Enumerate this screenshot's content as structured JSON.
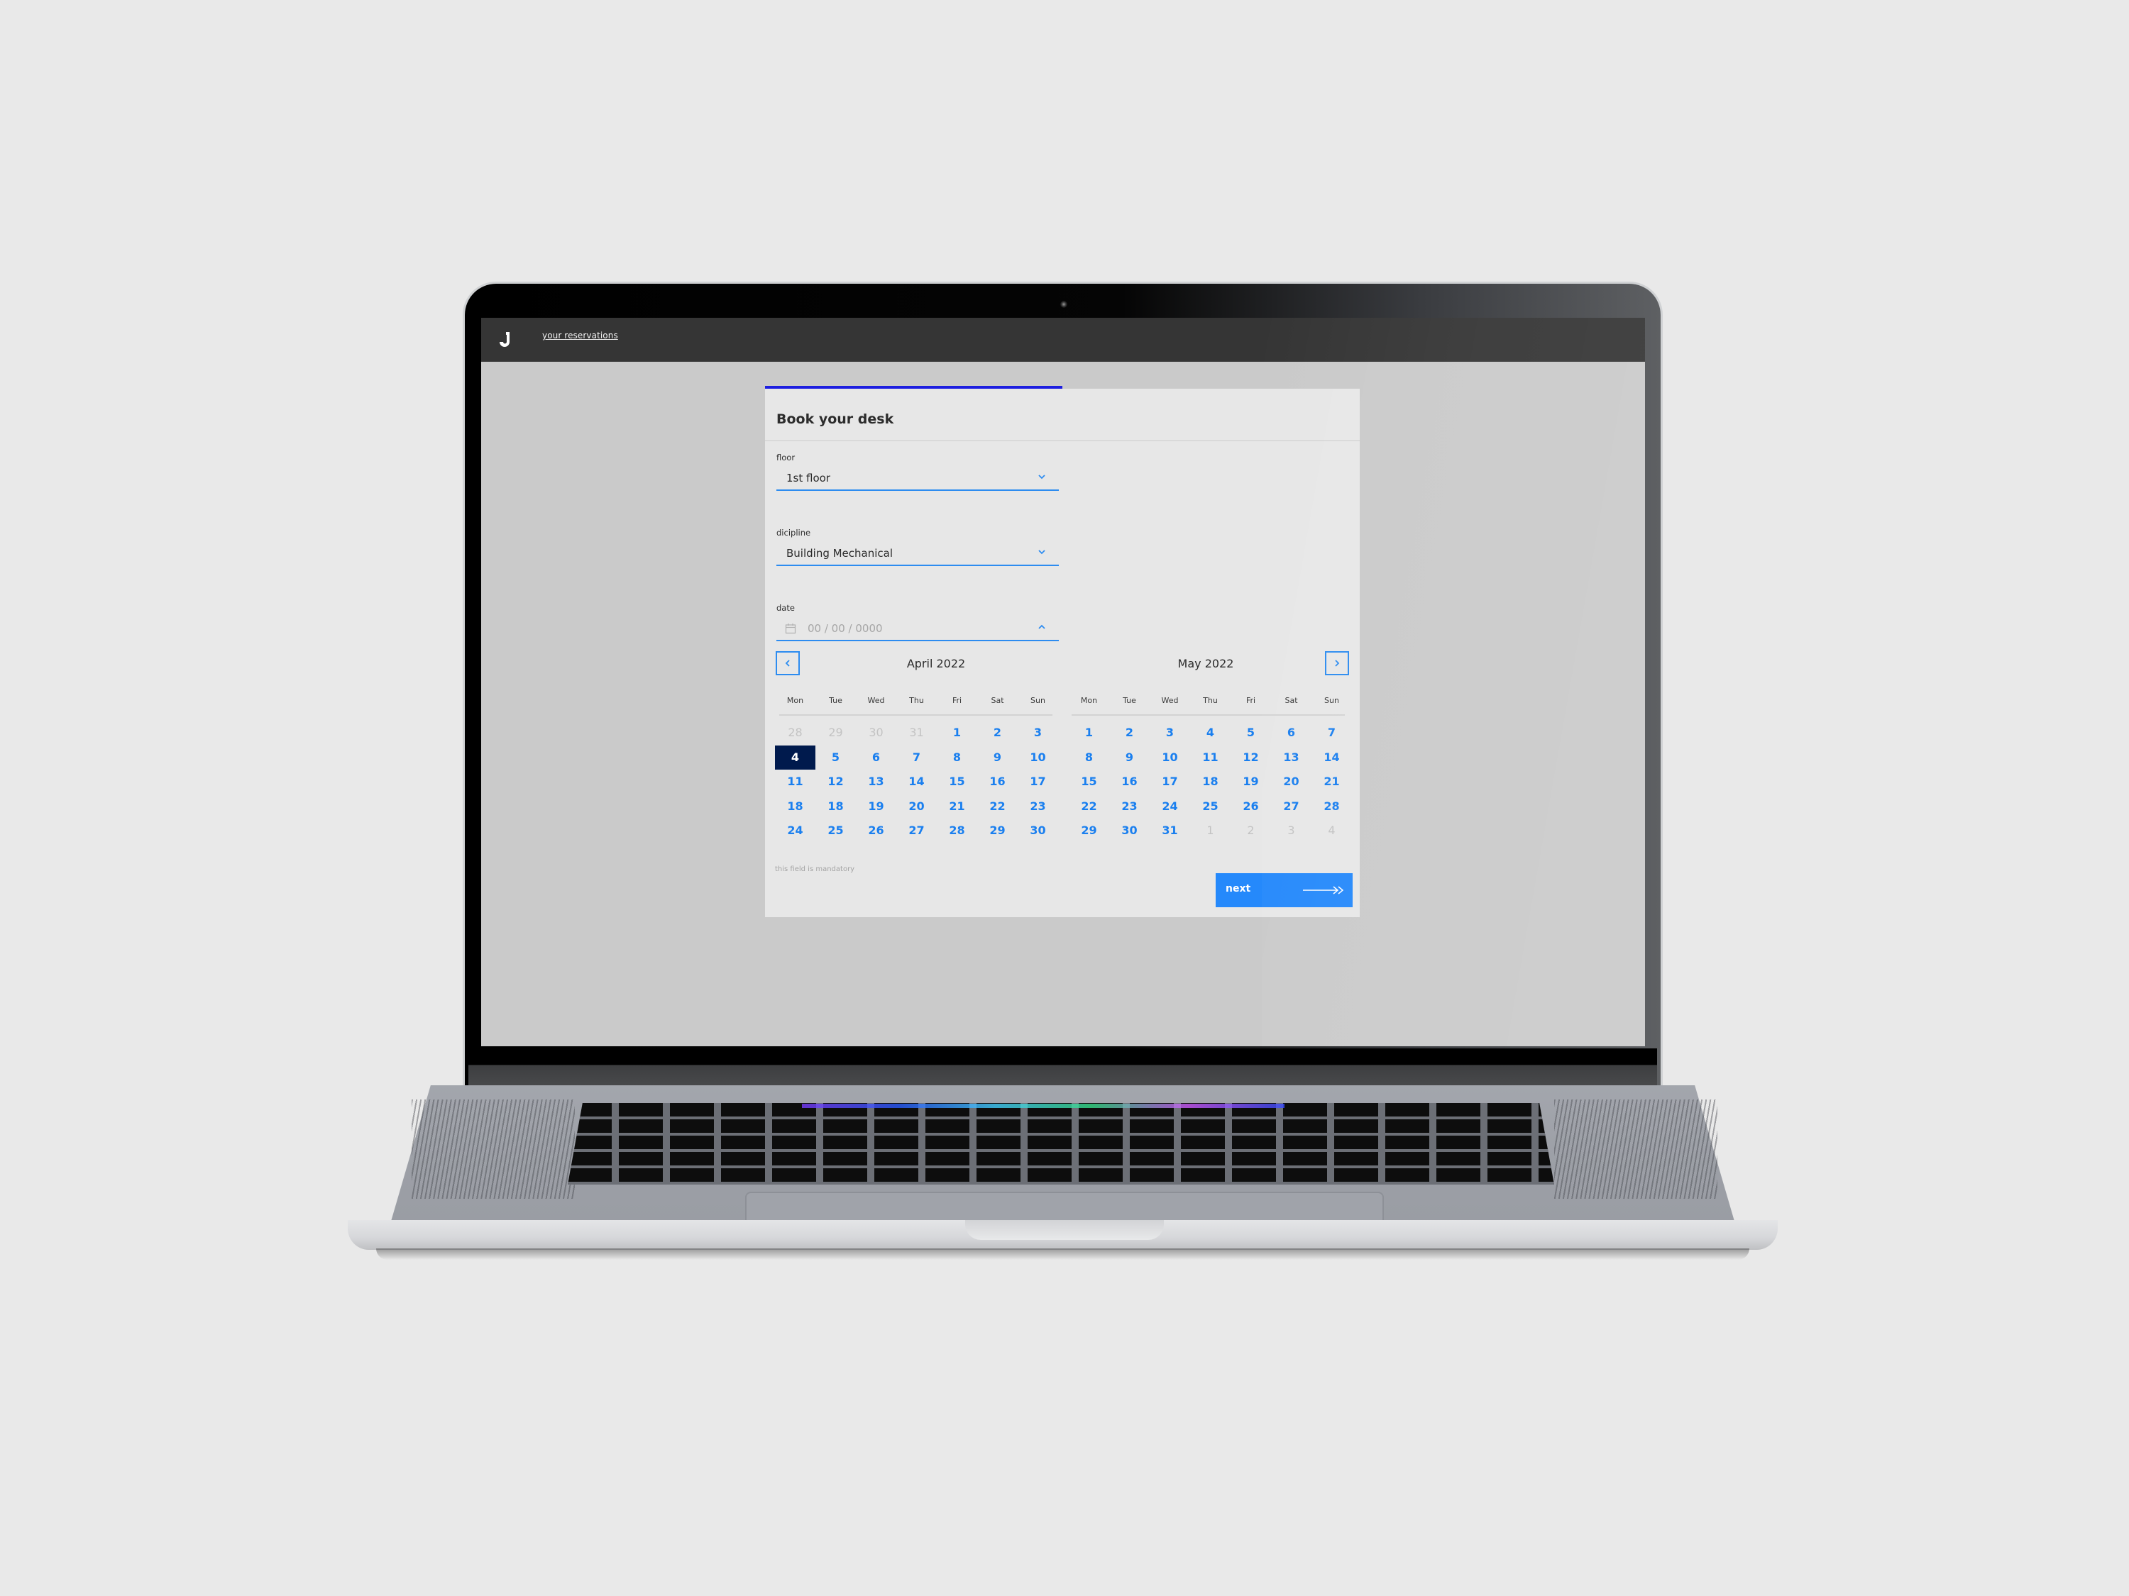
{
  "topbar": {
    "logo_icon": "j-logo-icon",
    "nav_link": "your reservations"
  },
  "booking": {
    "title": "Book your desk",
    "progress": 0.5,
    "floor": {
      "label": "floor",
      "value": "1st floor",
      "icon": "chevron-down-icon"
    },
    "discipline": {
      "label": "dicipline",
      "value": "Building Mechanical",
      "icon": "chevron-down-icon"
    },
    "date": {
      "label": "date",
      "placeholder": "00 / 00 / 0000",
      "leading_icon": "calendar-icon",
      "trailing_icon": "chevron-up-icon"
    },
    "hint": "this field is mandatory",
    "next_label": "next",
    "next_icon": "arrow-right-icon"
  },
  "calendar": {
    "prev_icon": "chevron-left-icon",
    "next_icon": "chevron-right-icon",
    "weekdays": [
      "Mon",
      "Tue",
      "Wed",
      "Thu",
      "Fri",
      "Sat",
      "Sun"
    ],
    "months": [
      {
        "title": "April 2022",
        "days": [
          {
            "d": "28",
            "muted": true
          },
          {
            "d": "29",
            "muted": true
          },
          {
            "d": "30",
            "muted": true
          },
          {
            "d": "31",
            "muted": true
          },
          {
            "d": "1"
          },
          {
            "d": "2"
          },
          {
            "d": "3"
          },
          {
            "d": "4",
            "selected": true
          },
          {
            "d": "5"
          },
          {
            "d": "6"
          },
          {
            "d": "7"
          },
          {
            "d": "8"
          },
          {
            "d": "9"
          },
          {
            "d": "10"
          },
          {
            "d": "11"
          },
          {
            "d": "12"
          },
          {
            "d": "13"
          },
          {
            "d": "14"
          },
          {
            "d": "15"
          },
          {
            "d": "16"
          },
          {
            "d": "17"
          },
          {
            "d": "18"
          },
          {
            "d": "18"
          },
          {
            "d": "19"
          },
          {
            "d": "20"
          },
          {
            "d": "21"
          },
          {
            "d": "22"
          },
          {
            "d": "23"
          },
          {
            "d": "24"
          },
          {
            "d": "25"
          },
          {
            "d": "26"
          },
          {
            "d": "27"
          },
          {
            "d": "28"
          },
          {
            "d": "29"
          },
          {
            "d": "30"
          }
        ]
      },
      {
        "title": "May 2022",
        "days": [
          {
            "d": "1"
          },
          {
            "d": "2"
          },
          {
            "d": "3"
          },
          {
            "d": "4"
          },
          {
            "d": "5"
          },
          {
            "d": "6"
          },
          {
            "d": "7"
          },
          {
            "d": "8"
          },
          {
            "d": "9"
          },
          {
            "d": "10"
          },
          {
            "d": "11"
          },
          {
            "d": "12"
          },
          {
            "d": "13"
          },
          {
            "d": "14"
          },
          {
            "d": "15"
          },
          {
            "d": "16"
          },
          {
            "d": "17"
          },
          {
            "d": "18"
          },
          {
            "d": "19"
          },
          {
            "d": "20"
          },
          {
            "d": "21"
          },
          {
            "d": "22"
          },
          {
            "d": "23"
          },
          {
            "d": "24"
          },
          {
            "d": "25"
          },
          {
            "d": "26"
          },
          {
            "d": "27"
          },
          {
            "d": "28"
          },
          {
            "d": "29"
          },
          {
            "d": "30"
          },
          {
            "d": "31"
          },
          {
            "d": "1",
            "muted": true
          },
          {
            "d": "2",
            "muted": true
          },
          {
            "d": "3",
            "muted": true
          },
          {
            "d": "4",
            "muted": true
          }
        ]
      }
    ]
  },
  "colors": {
    "accent": "#2589fb",
    "progress": "#1d1ee0",
    "selected_day": "#001a4d",
    "topbar": "#353535"
  }
}
